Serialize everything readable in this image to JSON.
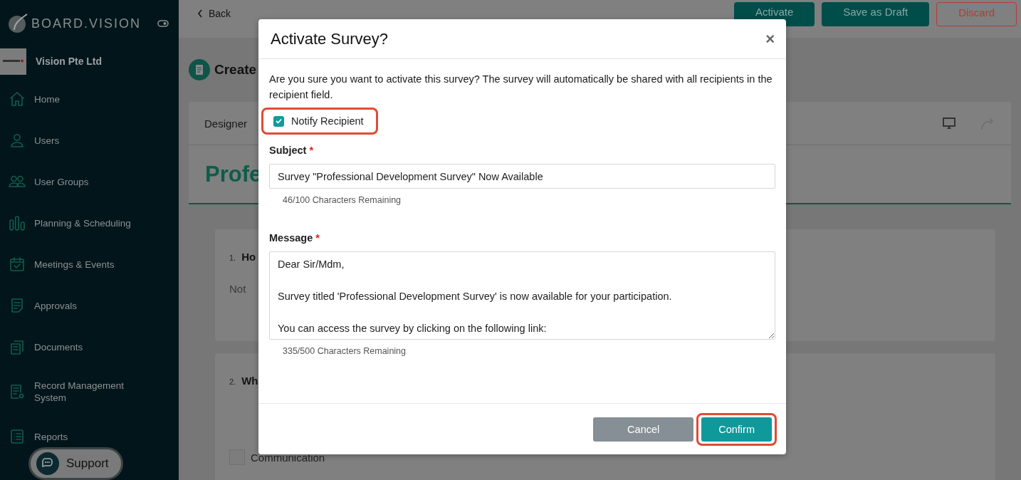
{
  "sidebar": {
    "brand": "BOARD.VISION",
    "organization": "Vision Pte Ltd",
    "items": [
      {
        "label": "Home"
      },
      {
        "label": "Users"
      },
      {
        "label": "User Groups"
      },
      {
        "label": "Planning & Scheduling"
      },
      {
        "label": "Meetings & Events"
      },
      {
        "label": "Approvals"
      },
      {
        "label": "Documents"
      },
      {
        "label": "Record Management System"
      },
      {
        "label": "Reports"
      }
    ],
    "support": "Support"
  },
  "header": {
    "back": "Back",
    "buttons": [
      {
        "label": "Activate",
        "kind": "primary"
      },
      {
        "label": "Save as Draft",
        "kind": "primary"
      },
      {
        "label": "Discard",
        "kind": "danger"
      }
    ]
  },
  "page": {
    "title": "Create",
    "tabs": [
      {
        "label": "Designer"
      }
    ],
    "survey_title": "Profe",
    "questions": [
      {
        "number": "1.",
        "text": "Ho",
        "answer_placeholder": "Not"
      },
      {
        "number": "2.",
        "text": "Wh",
        "options": [
          {
            "label": "Communication",
            "checked": false
          }
        ]
      }
    ]
  },
  "dialog": {
    "title": "Activate Survey?",
    "close": "×",
    "text": "Are you sure you want to activate this survey? The survey will automatically be shared with all recipients in the recipient field.",
    "notify": {
      "label": "Notify Recipient",
      "checked": true,
      "highlighted": true
    },
    "subject": {
      "label": "Subject",
      "required_mark": "*",
      "value": "Survey \"Professional Development Survey\" Now Available",
      "counter": "46/100 Characters Remaining"
    },
    "message": {
      "label": "Message",
      "required_mark": "*",
      "value": "Dear Sir/Mdm,\n\nSurvey titled 'Professional Development Survey' is now available for your participation.\n\nYou can access the survey by clicking on the following link:",
      "counter": "335/500 Characters Remaining"
    },
    "buttons": [
      {
        "label": "Cancel",
        "kind": "secondary",
        "highlighted": false
      },
      {
        "label": "Confirm",
        "kind": "primary",
        "highlighted": true
      }
    ]
  }
}
